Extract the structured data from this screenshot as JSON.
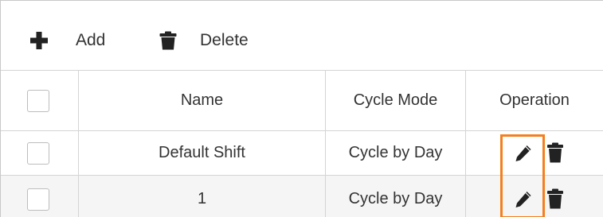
{
  "toolbar": {
    "add_label": "Add",
    "add_icon": "plus-icon",
    "delete_label": "Delete",
    "delete_icon": "trash-icon"
  },
  "table": {
    "columns": [
      "",
      "Name",
      "Cycle Mode",
      "Operation"
    ],
    "rows": [
      {
        "name": "Default Shift",
        "cycle_mode": "Cycle by Day",
        "checked": false
      },
      {
        "name": "1",
        "cycle_mode": "Cycle by Day",
        "checked": false
      }
    ],
    "operation_icons": [
      "pencil-icon",
      "trash-icon"
    ]
  },
  "colors": {
    "highlight": "#f47f20",
    "icon": "#222222",
    "border": "#d4d4d4",
    "alt_row": "#f5f5f5"
  }
}
